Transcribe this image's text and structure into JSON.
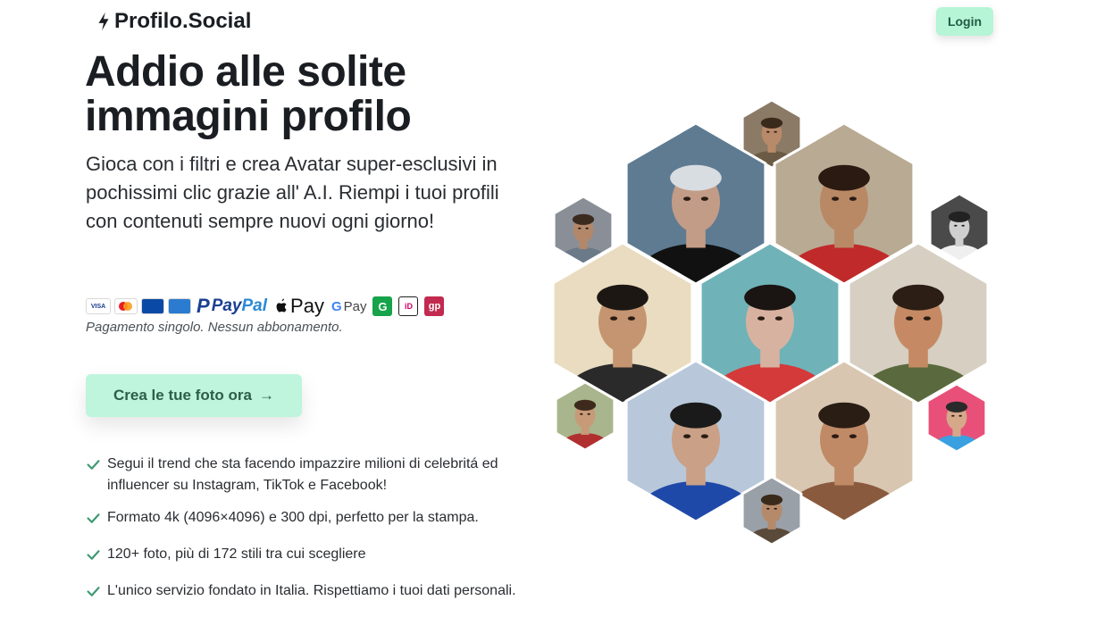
{
  "header": {
    "logo_text": "Profilo.Social",
    "logo_icon": "lightning-bolt-icon",
    "login_label": "Login"
  },
  "hero": {
    "title": "Addio alle solite immagini profilo",
    "subtitle": "Gioca con i filtri e crea Avatar super-esclusivi in pochissimi clic grazie all' A.I. Riempi i tuoi profili con contenuti sempre nuovi ogni giorno!"
  },
  "payments": {
    "methods": [
      "visa",
      "mastercard",
      "maestro",
      "amex",
      "paypal",
      "apple-pay",
      "google-pay",
      "gopay",
      "ideal",
      "giropay"
    ],
    "visa": "VISA",
    "paypal_pay": "Pay",
    "paypal_pal": "Pal",
    "apple_pay": "Pay",
    "google_pay_g": "G",
    "google_pay": "Pay",
    "gopay": "G",
    "ideal": "iD",
    "giropay": "gp",
    "note": "Pagamento singolo. Nessun abbonamento."
  },
  "cta": {
    "label": "Crea le tue foto ora",
    "arrow": "→"
  },
  "features": [
    "Segui il trend che sta facendo impazzire milioni di celebritá ed influencer su Instagram, TikTok e Facebook!",
    "Formato 4k (4096×4096) e 300 dpi, perfetto per la stampa.",
    "120+ foto, più di 172 stili tra cui scegliere",
    "L'unico servizio fondato in Italia. Rispettiamo i tuoi dati personali."
  ],
  "colors": {
    "accent": "#bff5dc",
    "accent_text": "#2d5e47",
    "check": "#3f9a73",
    "title": "#1a1d21"
  },
  "gallery": {
    "tiles": [
      {
        "name": "portrait-adventurer-hat"
      },
      {
        "name": "portrait-sunglasses"
      },
      {
        "name": "portrait-tribal-headdress"
      },
      {
        "name": "portrait-bw-suit"
      },
      {
        "name": "portrait-mountain"
      },
      {
        "name": "portrait-agent-gun"
      },
      {
        "name": "portrait-paint-splash"
      },
      {
        "name": "portrait-soldier"
      },
      {
        "name": "portrait-garden"
      },
      {
        "name": "portrait-superman"
      },
      {
        "name": "portrait-realistic"
      },
      {
        "name": "portrait-popart"
      },
      {
        "name": "portrait-indiana"
      }
    ]
  }
}
